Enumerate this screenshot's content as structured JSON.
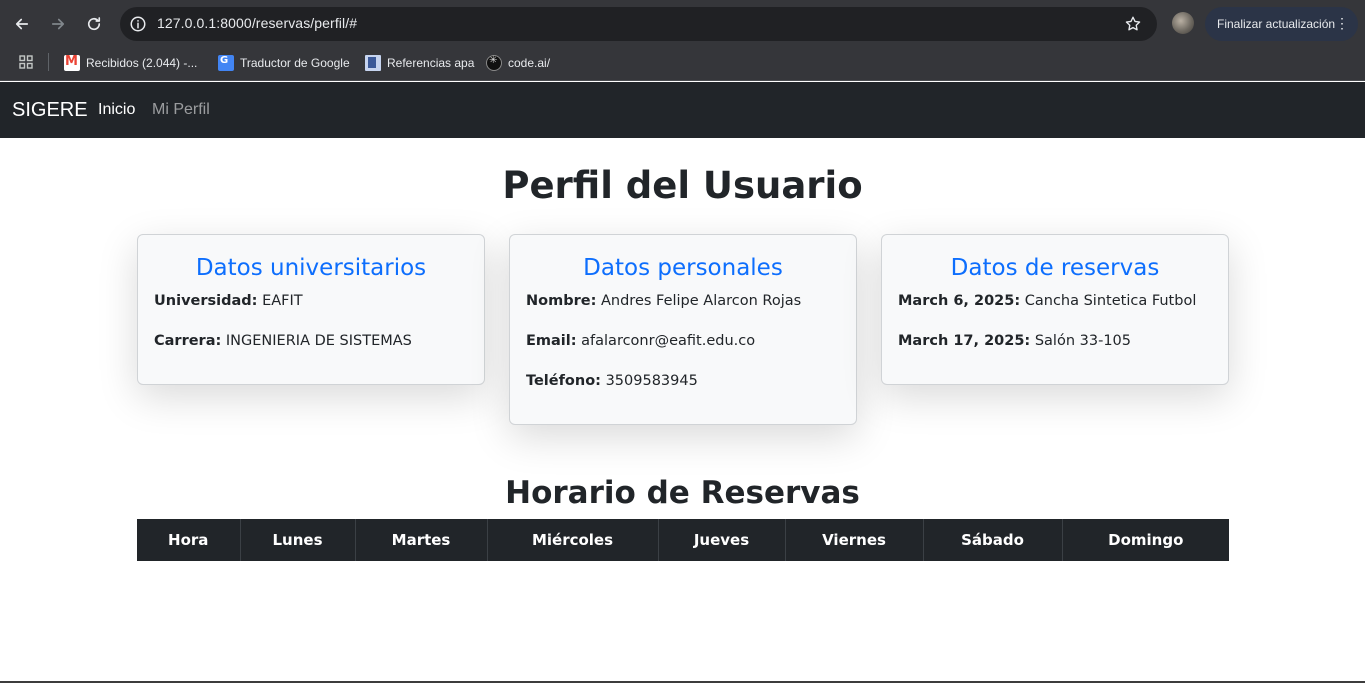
{
  "browser": {
    "url": "127.0.0.1:8000/reservas/perfil/#",
    "update_button_label": "Finalizar actualización",
    "bookmarks": [
      {
        "label": "Recibidos (2.044) -...",
        "icon": "gmail-icon"
      },
      {
        "label": "Traductor de Google",
        "icon": "google-translate-icon"
      },
      {
        "label": "Referencias apa",
        "icon": "book-icon"
      },
      {
        "label": "code.ai/",
        "icon": "code-ai-icon"
      }
    ]
  },
  "navbar": {
    "brand": "SIGERE",
    "links": [
      {
        "label": "Inicio",
        "active": true
      },
      {
        "label": "Mi Perfil",
        "active": false
      }
    ]
  },
  "page": {
    "title": "Perfil del Usuario",
    "cards": [
      {
        "title": "Datos universitarios",
        "fields": [
          {
            "label": "Universidad:",
            "value": "EAFIT"
          },
          {
            "label": "Carrera:",
            "value": "INGENIERIA DE SISTEMAS"
          }
        ]
      },
      {
        "title": "Datos personales",
        "fields": [
          {
            "label": "Nombre:",
            "value": "Andres Felipe Alarcon Rojas"
          },
          {
            "label": "Email:",
            "value": "afalarconr@eafit.edu.co"
          },
          {
            "label": "Teléfono:",
            "value": "3509583945"
          }
        ]
      },
      {
        "title": "Datos de reservas",
        "fields": [
          {
            "label": "March 6, 2025:",
            "value": "Cancha Sintetica Futbol"
          },
          {
            "label": "March 17, 2025:",
            "value": "Salón 33-105"
          }
        ]
      }
    ],
    "schedule": {
      "title": "Horario de Reservas",
      "columns": [
        "Hora",
        "Lunes",
        "Martes",
        "Miércoles",
        "Jueves",
        "Viernes",
        "Sábado",
        "Domingo"
      ]
    }
  },
  "colors": {
    "navbar_bg": "#212529",
    "card_title": "#0d6efd",
    "table_header_bg": "#212529"
  }
}
